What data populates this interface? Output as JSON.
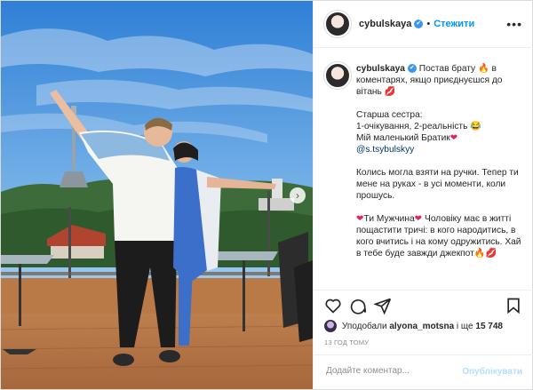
{
  "post": {
    "username": "cybulskaya",
    "verified_glyph": "✔",
    "follow_label": "Стежити",
    "dot": "•",
    "more_glyph": "•••",
    "next_glyph": "›"
  },
  "caption": {
    "username": "cybulskaya",
    "line1": "Постав брату",
    "line1_emoji": "🔥",
    "line1_rest": "в коментарях, якщо приєднуєшся до вітань",
    "line1_end_emoji": "💋",
    "p2_l1": "Старша сестра:",
    "p2_l2": "1-очікування, 2-реальність",
    "p2_l2_emoji": "😂",
    "p2_l3": "Мій маленький Братик",
    "p2_l3_emoji": "❤",
    "p2_tag": "@s.tsybulskyy",
    "p3": "Колись могла взяти на ручки. Тепер ти мене на руках - в усі моменти, коли прошусь.",
    "p4_start_emoji": "❤",
    "p4_a": "Ти Мужчина",
    "p4_mid_emoji": "❤",
    "p4_b": "Чоловіку має в житті пощастити тричі: в кого народитись, в кого вчитись і на кому одружитись. Хай в тебе буде завжди джекпот",
    "p4_end_emoji1": "🔥",
    "p4_end_emoji2": "💋"
  },
  "likes": {
    "prefix": "Уподобали",
    "user": "alyona_motsna",
    "middle": "і ще",
    "count": "15 748"
  },
  "time": "13 ГОД ТОМУ",
  "comment_box": {
    "placeholder": "Додайте коментар...",
    "publish_label": "Опублікувати"
  },
  "icons": {
    "like": "heart-outline-icon",
    "comment": "speech-bubble-icon",
    "share": "paper-plane-icon",
    "save": "bookmark-icon"
  }
}
